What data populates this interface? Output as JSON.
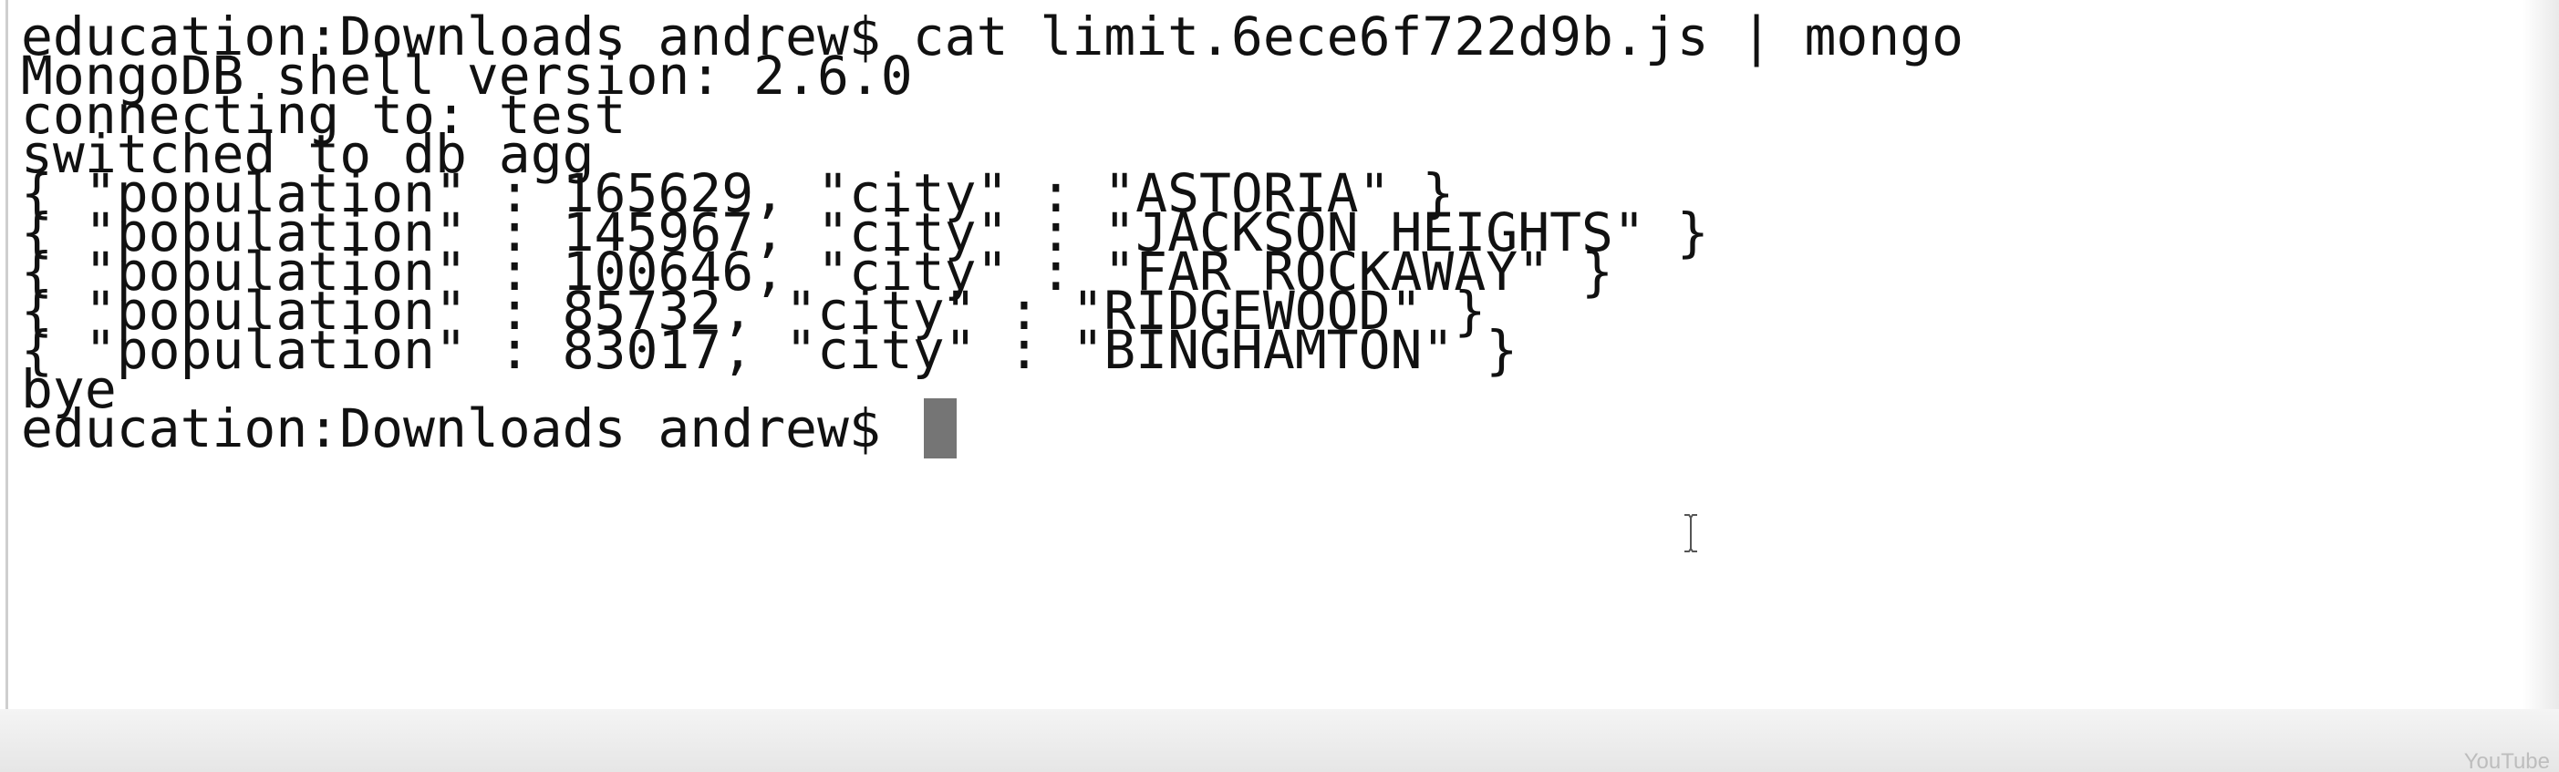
{
  "terminal": {
    "lines": [
      "education:Downloads andrew$ cat limit.6ece6f722d9b.js | mongo",
      "MongoDB shell version: 2.6.0",
      "connecting to: test",
      "switched to db agg",
      "{ \"population\" : 165629, \"city\" : \"ASTORIA\" }",
      "{ \"population\" : 145967, \"city\" : \"JACKSON HEIGHTS\" }",
      "{ \"population\" : 100646, \"city\" : \"FAR ROCKAWAY\" }",
      "{ \"population\" : 85732, \"city\" : \"RIDGEWOOD\" }",
      "{ \"population\" : 83017, \"city\" : \"BINGHAMTON\" }",
      "bye"
    ],
    "prompt": "education:Downloads andrew$ ",
    "cursor_icon": "text-cursor-block",
    "pointer_icon": "ibeam-icon",
    "colors": {
      "background": "#ffffff",
      "text": "#111111",
      "cursor": "#757575"
    }
  },
  "overlay": {
    "watermark": "YouTube"
  }
}
